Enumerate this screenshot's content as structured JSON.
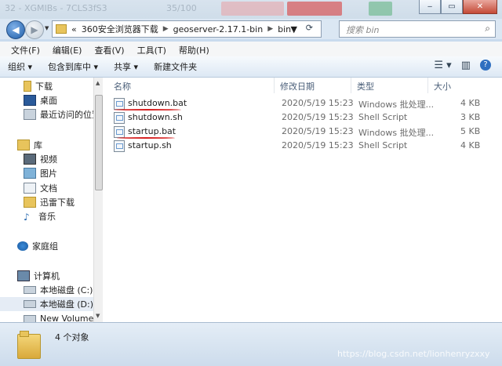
{
  "background": {
    "blurred_text": [
      "32 - XGMIBs - 7CLS3fS3",
      "35/100"
    ],
    "window_buttons": [
      "‒",
      "▭",
      "✕"
    ]
  },
  "address": {
    "crumbs": [
      "«",
      "360安全浏览器下载",
      "geoserver-2.17.1-bin",
      "bin"
    ],
    "search_placeholder": "搜索 bin"
  },
  "menu": [
    "文件(F)",
    "编辑(E)",
    "查看(V)",
    "工具(T)",
    "帮助(H)"
  ],
  "toolbar": {
    "organize": "组织 ▾",
    "include_library": "包含到库中 ▾",
    "share": "共享 ▾",
    "new_folder": "新建文件夹"
  },
  "nav": {
    "downloads": "下载",
    "desktop": "桌面",
    "recent": "最近访问的位置",
    "library": "库",
    "video": "视频",
    "pictures": "图片",
    "docs": "文档",
    "thunder": "迅雷下载",
    "music": "音乐",
    "homegroup": "家庭组",
    "computer": "计算机",
    "disk_c": "本地磁盘 (C:)",
    "disk_d": "本地磁盘 (D:)",
    "new_volume": "New Volume ("
  },
  "columns": {
    "name": "名称",
    "modified": "修改日期",
    "type": "类型",
    "size": "大小"
  },
  "files": [
    {
      "name": "shutdown.bat",
      "modified": "2020/5/19 15:23",
      "type": "Windows 批处理...",
      "size": "4 KB"
    },
    {
      "name": "shutdown.sh",
      "modified": "2020/5/19 15:23",
      "type": "Shell Script",
      "size": "3 KB"
    },
    {
      "name": "startup.bat",
      "modified": "2020/5/19 15:23",
      "type": "Windows 批处理...",
      "size": "5 KB"
    },
    {
      "name": "startup.sh",
      "modified": "2020/5/19 15:23",
      "type": "Shell Script",
      "size": "4 KB"
    }
  ],
  "status": {
    "count": "4 个对象"
  },
  "watermark": "https://blog.csdn.net/lionhenryzxxy"
}
